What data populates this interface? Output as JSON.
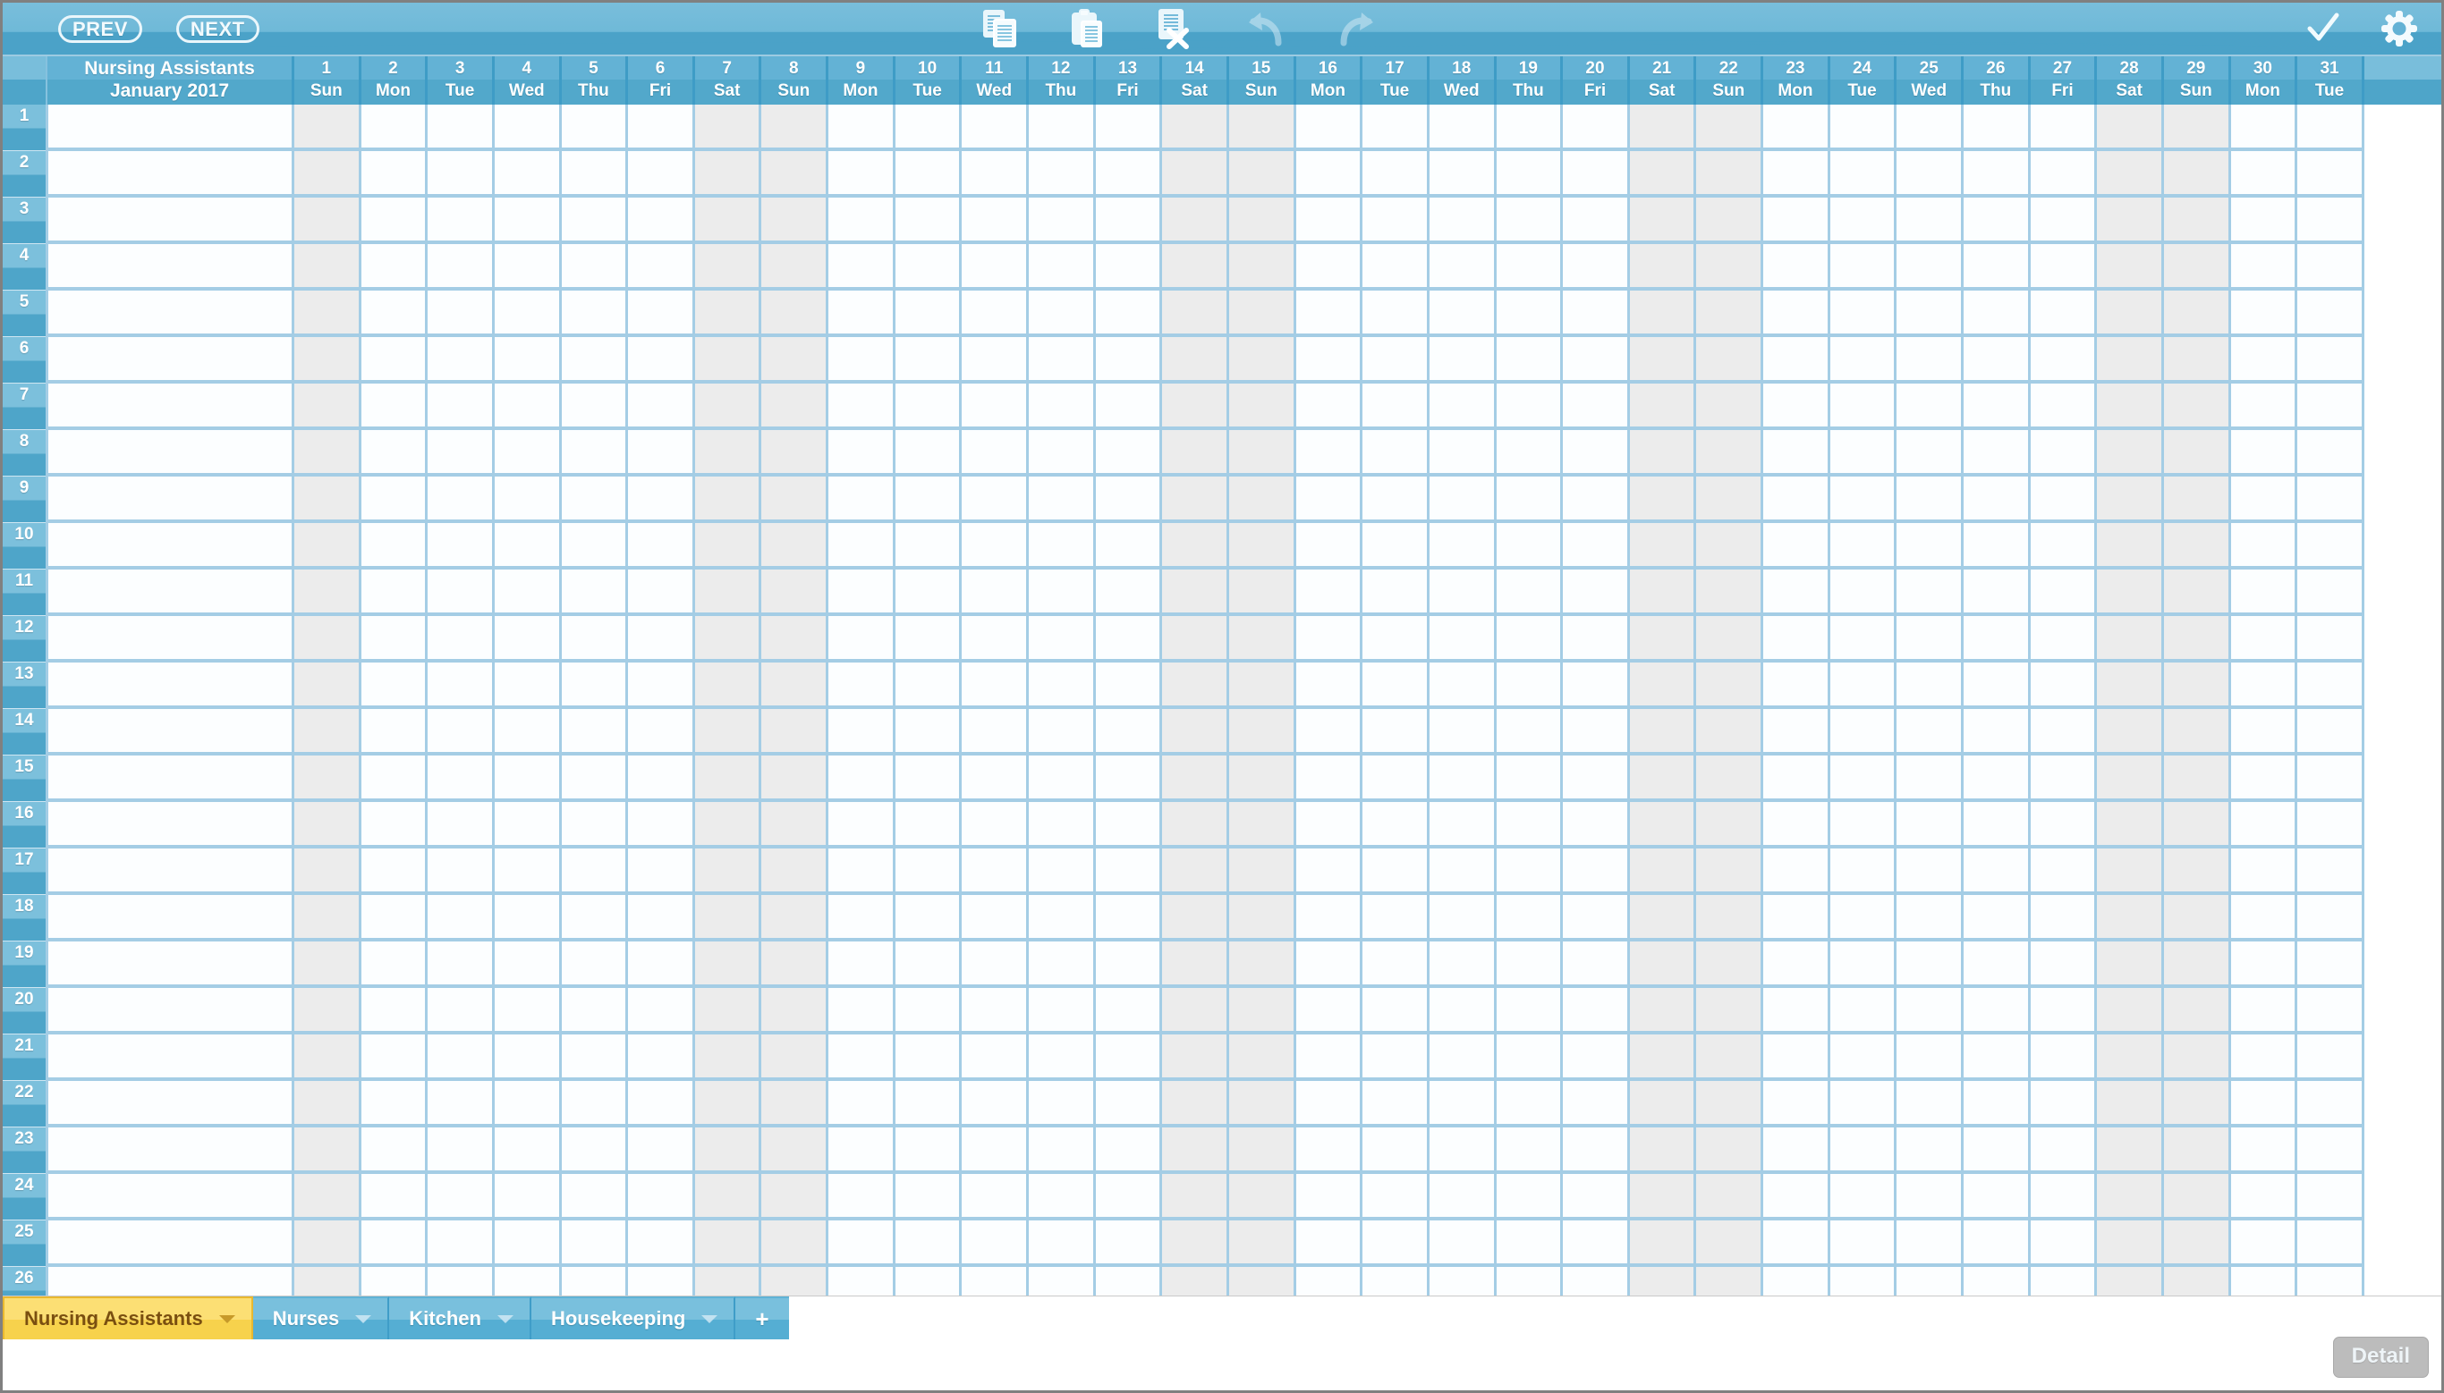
{
  "toolbar": {
    "prev_label": "PREV",
    "next_label": "NEXT",
    "icons": [
      {
        "name": "copy-icon",
        "label": "Copy"
      },
      {
        "name": "paste-icon",
        "label": "Paste"
      },
      {
        "name": "delete-shift-icon",
        "label": "Delete"
      },
      {
        "name": "undo-icon",
        "label": "Undo"
      },
      {
        "name": "redo-icon",
        "label": "Redo"
      }
    ],
    "right_icons": [
      {
        "name": "check-icon",
        "label": "Confirm"
      },
      {
        "name": "gear-icon",
        "label": "Settings"
      }
    ]
  },
  "schedule": {
    "group_title": "Nursing Assistants",
    "period_label": "January 2017",
    "row_count": 26,
    "row_numbers": [
      1,
      2,
      3,
      4,
      5,
      6,
      7,
      8,
      9,
      10,
      11,
      12,
      13,
      14,
      15,
      16,
      17,
      18,
      19,
      20,
      21,
      22,
      23,
      24,
      25,
      26
    ],
    "days": [
      {
        "num": "1",
        "dow": "Sun",
        "weekend": true
      },
      {
        "num": "2",
        "dow": "Mon",
        "weekend": false
      },
      {
        "num": "3",
        "dow": "Tue",
        "weekend": false
      },
      {
        "num": "4",
        "dow": "Wed",
        "weekend": false
      },
      {
        "num": "5",
        "dow": "Thu",
        "weekend": false
      },
      {
        "num": "6",
        "dow": "Fri",
        "weekend": false
      },
      {
        "num": "7",
        "dow": "Sat",
        "weekend": true
      },
      {
        "num": "8",
        "dow": "Sun",
        "weekend": true
      },
      {
        "num": "9",
        "dow": "Mon",
        "weekend": false
      },
      {
        "num": "10",
        "dow": "Tue",
        "weekend": false
      },
      {
        "num": "11",
        "dow": "Wed",
        "weekend": false
      },
      {
        "num": "12",
        "dow": "Thu",
        "weekend": false
      },
      {
        "num": "13",
        "dow": "Fri",
        "weekend": false
      },
      {
        "num": "14",
        "dow": "Sat",
        "weekend": true
      },
      {
        "num": "15",
        "dow": "Sun",
        "weekend": true
      },
      {
        "num": "16",
        "dow": "Mon",
        "weekend": false
      },
      {
        "num": "17",
        "dow": "Tue",
        "weekend": false
      },
      {
        "num": "18",
        "dow": "Wed",
        "weekend": false
      },
      {
        "num": "19",
        "dow": "Thu",
        "weekend": false
      },
      {
        "num": "20",
        "dow": "Fri",
        "weekend": false
      },
      {
        "num": "21",
        "dow": "Sat",
        "weekend": true
      },
      {
        "num": "22",
        "dow": "Sun",
        "weekend": true
      },
      {
        "num": "23",
        "dow": "Mon",
        "weekend": false
      },
      {
        "num": "24",
        "dow": "Tue",
        "weekend": false
      },
      {
        "num": "25",
        "dow": "Wed",
        "weekend": false
      },
      {
        "num": "26",
        "dow": "Thu",
        "weekend": false
      },
      {
        "num": "27",
        "dow": "Fri",
        "weekend": false
      },
      {
        "num": "28",
        "dow": "Sat",
        "weekend": true
      },
      {
        "num": "29",
        "dow": "Sun",
        "weekend": true
      },
      {
        "num": "30",
        "dow": "Mon",
        "weekend": false
      },
      {
        "num": "31",
        "dow": "Tue",
        "weekend": false
      }
    ],
    "cells": []
  },
  "tabs": [
    {
      "label": "Nursing Assistants",
      "active": true
    },
    {
      "label": "Nurses",
      "active": false
    },
    {
      "label": "Kitchen",
      "active": false
    },
    {
      "label": "Housekeeping",
      "active": false
    }
  ],
  "add_tab_label": "+",
  "footer": {
    "detail_label": "Detail"
  },
  "colors": {
    "toolbar_top": "#6fb9d8",
    "toolbar_bottom": "#4ba2c8",
    "header_blue": "#52a8cb",
    "grid_line": "#a4cde5",
    "weekend_cell": "#ececec",
    "cell_bg": "#fcfeff",
    "active_tab": "#f7d24c",
    "active_tab_text": "#7a4f10",
    "detail_button": "#bcbcbc"
  }
}
